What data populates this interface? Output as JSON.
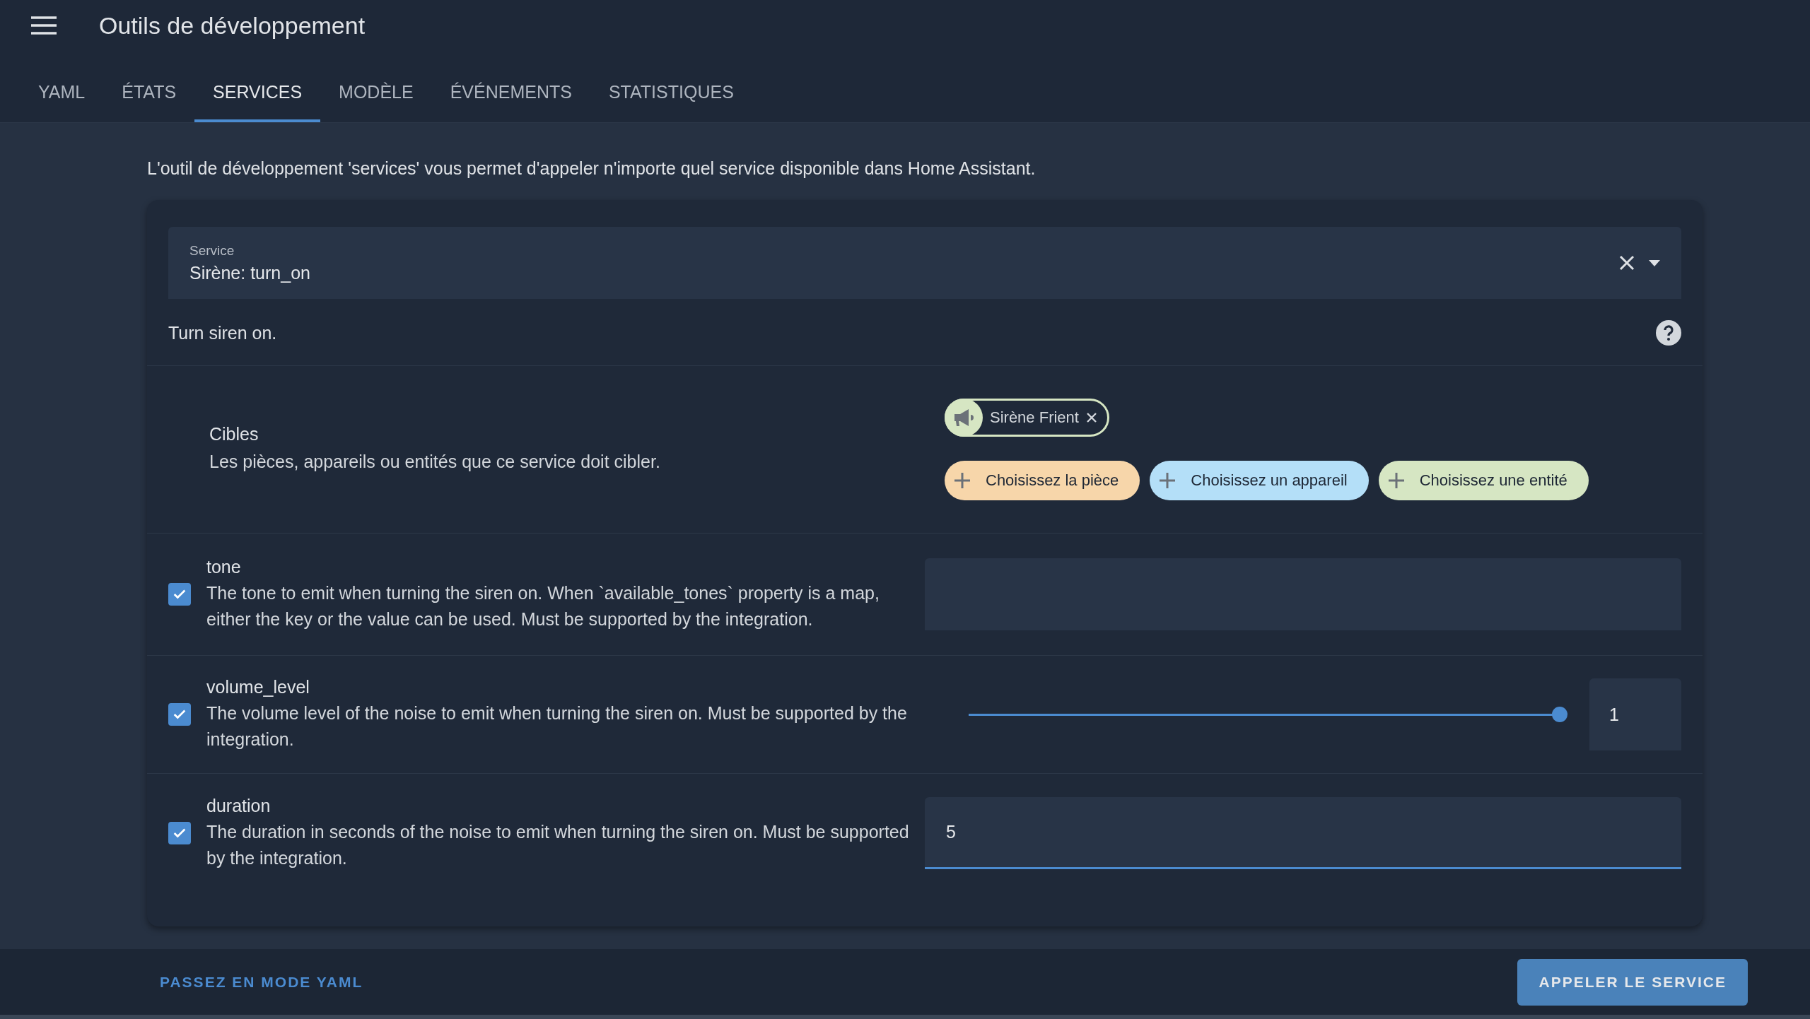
{
  "header": {
    "title": "Outils de développement"
  },
  "tabs": [
    {
      "label": "YAML",
      "selected": false
    },
    {
      "label": "ÉTATS",
      "selected": false
    },
    {
      "label": "SERVICES",
      "selected": true
    },
    {
      "label": "MODÈLE",
      "selected": false
    },
    {
      "label": "ÉVÉNEMENTS",
      "selected": false
    },
    {
      "label": "STATISTIQUES",
      "selected": false
    }
  ],
  "description": "L'outil de développement 'services' vous permet d'appeler n'importe quel service disponible dans Home Assistant.",
  "service_field": {
    "label": "Service",
    "value": "Sirène: turn_on"
  },
  "service_description": "Turn siren on.",
  "targets": {
    "title": "Cibles",
    "description": "Les pièces, appareils ou entités que ce service doit cibler.",
    "chips": [
      {
        "label": "Sirène Frient"
      }
    ],
    "pickers": [
      {
        "label": "Choisissez la pièce",
        "color": "#f7d6aa"
      },
      {
        "label": "Choisissez un appareil",
        "color": "#b4dff8"
      },
      {
        "label": "Choisissez une entité",
        "color": "#d6e6c3"
      }
    ]
  },
  "fields": [
    {
      "kind": "text",
      "name": "tone",
      "checked": true,
      "description": "The tone to emit when turning the siren on. When `available_tones` property is a map, either the key or the value can be used. Must be supported by the integration."
    },
    {
      "kind": "slider",
      "name": "volume_level",
      "checked": true,
      "description": "The volume level of the noise to emit when turning the siren on. Must be supported by the integration.",
      "level": 1,
      "value": "1"
    },
    {
      "kind": "number",
      "name": "duration",
      "checked": true,
      "description": "The duration in seconds of the noise to emit when turning the siren on. Must be supported by the integration.",
      "value": "5"
    }
  ],
  "footer": {
    "yaml_link": "PASSEZ EN MODE YAML",
    "call_button": "APPELER LE SERVICE"
  }
}
